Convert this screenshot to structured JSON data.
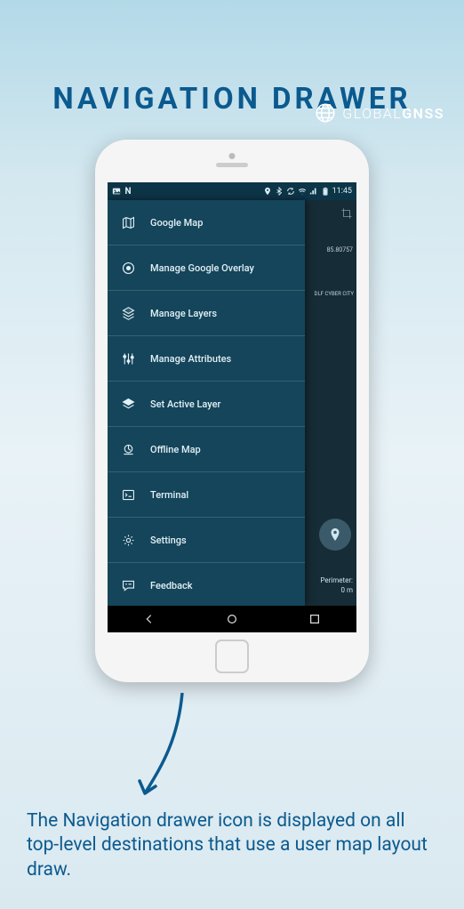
{
  "brand": {
    "prefix": "GLOBAL",
    "suffix": "GNSS"
  },
  "title": "NAVIGATION DRAWER",
  "statusbar": {
    "time": "11:45",
    "left_icons": [
      "image",
      "N"
    ],
    "right_icons": [
      "location",
      "bluetooth",
      "sync",
      "wifi",
      "signal",
      "battery"
    ]
  },
  "map": {
    "coords": "85.80757",
    "placelabel": "DLF CYBER CITY",
    "perimeter_label": "Perimeter:",
    "perimeter_value": "0 m"
  },
  "drawer": {
    "items": [
      {
        "label": "Google Map",
        "icon": "map-icon"
      },
      {
        "label": "Manage Google Overlay",
        "icon": "overlay-icon"
      },
      {
        "label": "Manage Layers",
        "icon": "layers-icon"
      },
      {
        "label": "Manage Attributes",
        "icon": "sliders-icon"
      },
      {
        "label": "Set Active Layer",
        "icon": "active-layer-icon"
      },
      {
        "label": "Offline Map",
        "icon": "offline-map-icon"
      },
      {
        "label": "Terminal",
        "icon": "terminal-icon"
      },
      {
        "label": "Settings",
        "icon": "settings-icon"
      },
      {
        "label": "Feedback",
        "icon": "feedback-icon"
      }
    ]
  },
  "description": "The Navigation drawer icon is displayed on all top-level destinations that use a user map layout draw."
}
